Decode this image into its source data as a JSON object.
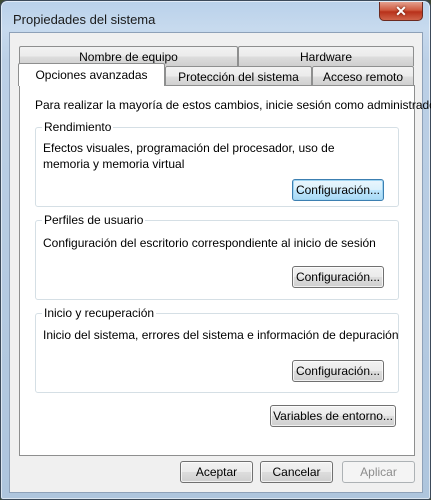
{
  "window": {
    "title": "Propiedades del sistema",
    "close_glyph": "✕"
  },
  "tabs": {
    "row1": [
      {
        "label": "Nombre de equipo",
        "selected": false
      },
      {
        "label": "Hardware",
        "selected": false
      }
    ],
    "row2": [
      {
        "label": "Opciones avanzadas",
        "selected": true
      },
      {
        "label": "Protección del sistema",
        "selected": false
      },
      {
        "label": "Acceso remoto",
        "selected": false
      }
    ]
  },
  "panel": {
    "intro": "Para realizar la mayoría de estos cambios, inicie sesión como administrador.",
    "performance": {
      "title": "Rendimiento",
      "description": "Efectos visuales, programación del procesador, uso de memoria y memoria virtual",
      "button": "Configuración..."
    },
    "user_profiles": {
      "title": "Perfiles de usuario",
      "description": "Configuración del escritorio correspondiente al inicio de sesión",
      "button": "Configuración..."
    },
    "startup_recovery": {
      "title": "Inicio y recuperación",
      "description": "Inicio del sistema, errores del sistema e información de depuración",
      "button": "Configuración..."
    },
    "env_button": "Variables de entorno..."
  },
  "footer": {
    "ok": "Aceptar",
    "cancel": "Cancelar",
    "apply": "Aplicar"
  },
  "colors": {
    "focus_border": "#3c7fb1",
    "close_red": "#c7432a",
    "title_glass": "#b9d1ea"
  }
}
